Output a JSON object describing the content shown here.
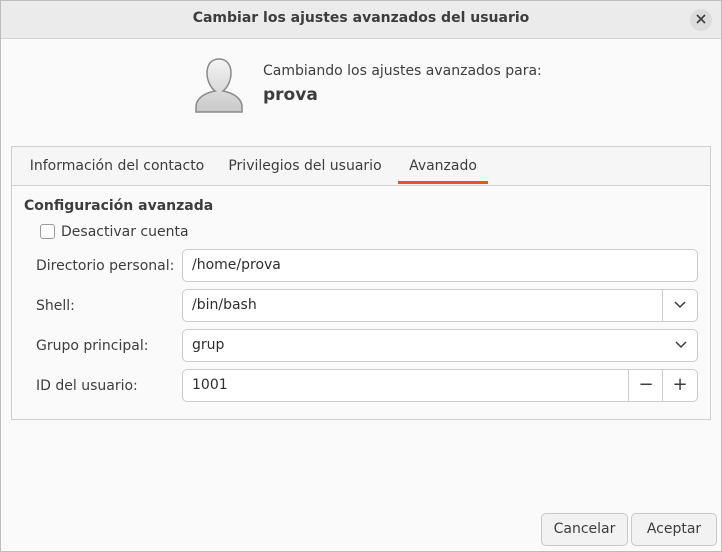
{
  "window": {
    "title": "Cambiar los ajustes avanzados del usuario",
    "close_icon": "close-icon"
  },
  "header": {
    "subtitle": "Cambiando los ajustes avanzados para:",
    "username": "prova",
    "avatar_icon": "user-avatar-icon"
  },
  "tabs": [
    {
      "label": "Información del contacto",
      "active": false
    },
    {
      "label": "Privilegios del usuario",
      "active": false
    },
    {
      "label": "Avanzado",
      "active": true
    }
  ],
  "advanced": {
    "section_title": "Configuración avanzada",
    "disable_account_label": "Desactivar cuenta",
    "disable_account_checked": false,
    "home_dir_label": "Directorio personal:",
    "home_dir_value": "/home/prova",
    "shell_label": "Shell:",
    "shell_value": "/bin/bash",
    "group_label": "Grupo principal:",
    "group_value": "grup",
    "uid_label": "ID del usuario:",
    "uid_value": "1001",
    "uid_minus": "−",
    "uid_plus": "+"
  },
  "buttons": {
    "cancel": "Cancelar",
    "accept": "Aceptar"
  },
  "colors": {
    "accent": "#e95420",
    "background": "#fafafa",
    "titlebar": "#ebebeb"
  }
}
